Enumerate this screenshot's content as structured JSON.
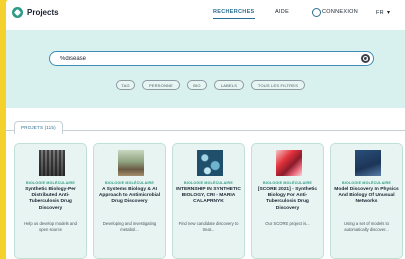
{
  "header": {
    "logo_text": "Projects",
    "nav": {
      "recherches": "RECHERCHES",
      "aide": "AIDE",
      "connexion": "CONNEXION",
      "lang": "FR"
    }
  },
  "search": {
    "value": "%disease",
    "placeholder": ""
  },
  "filters": [
    "TAG",
    "PERSONNE",
    "BIO",
    "LABELS",
    "TOUS LES FILTRES"
  ],
  "results": {
    "tab_label": "PROJETS (115)"
  },
  "cards": [
    {
      "tag": "BIOLOGIE MOLÉCULAIRE",
      "title": "Synthetic Biology-Per Distributed Anti-Tuberculosis Drug Discovery",
      "desc": "Help us develop models and open source"
    },
    {
      "tag": "BIOLOGIE MOLÉCULAIRE",
      "title": "A Systems Biology & AI Approach to Antimicrobial Drug Discovery",
      "desc": "Developing and investigating metabol..."
    },
    {
      "tag": "BIOLOGIE MOLÉCULAIRE",
      "title": "INTERNSHIP IN SYNTHETIC BIOLOGY, CRI - MARIA CALAPRNYK",
      "desc": "Find new candidate discovery to treat..."
    },
    {
      "tag": "BIOLOGIE MOLÉCULAIRE",
      "title": "[SCORE 2021] - Synthetic Biology For Anti-Tuberculosis Drug Discovery",
      "desc": "Our SCORE project is..."
    },
    {
      "tag": "BIOLOGIE MOLÉCULAIRE",
      "title": "Model Discovery In Physics And Biology Of Unusual Networks",
      "desc": "Using a set of models to automatically discover..."
    }
  ],
  "colors": {
    "accent": "#2a6f92",
    "brand": "#2d9b85",
    "band": "#d9f1ee",
    "outer": "#f4d12c"
  }
}
